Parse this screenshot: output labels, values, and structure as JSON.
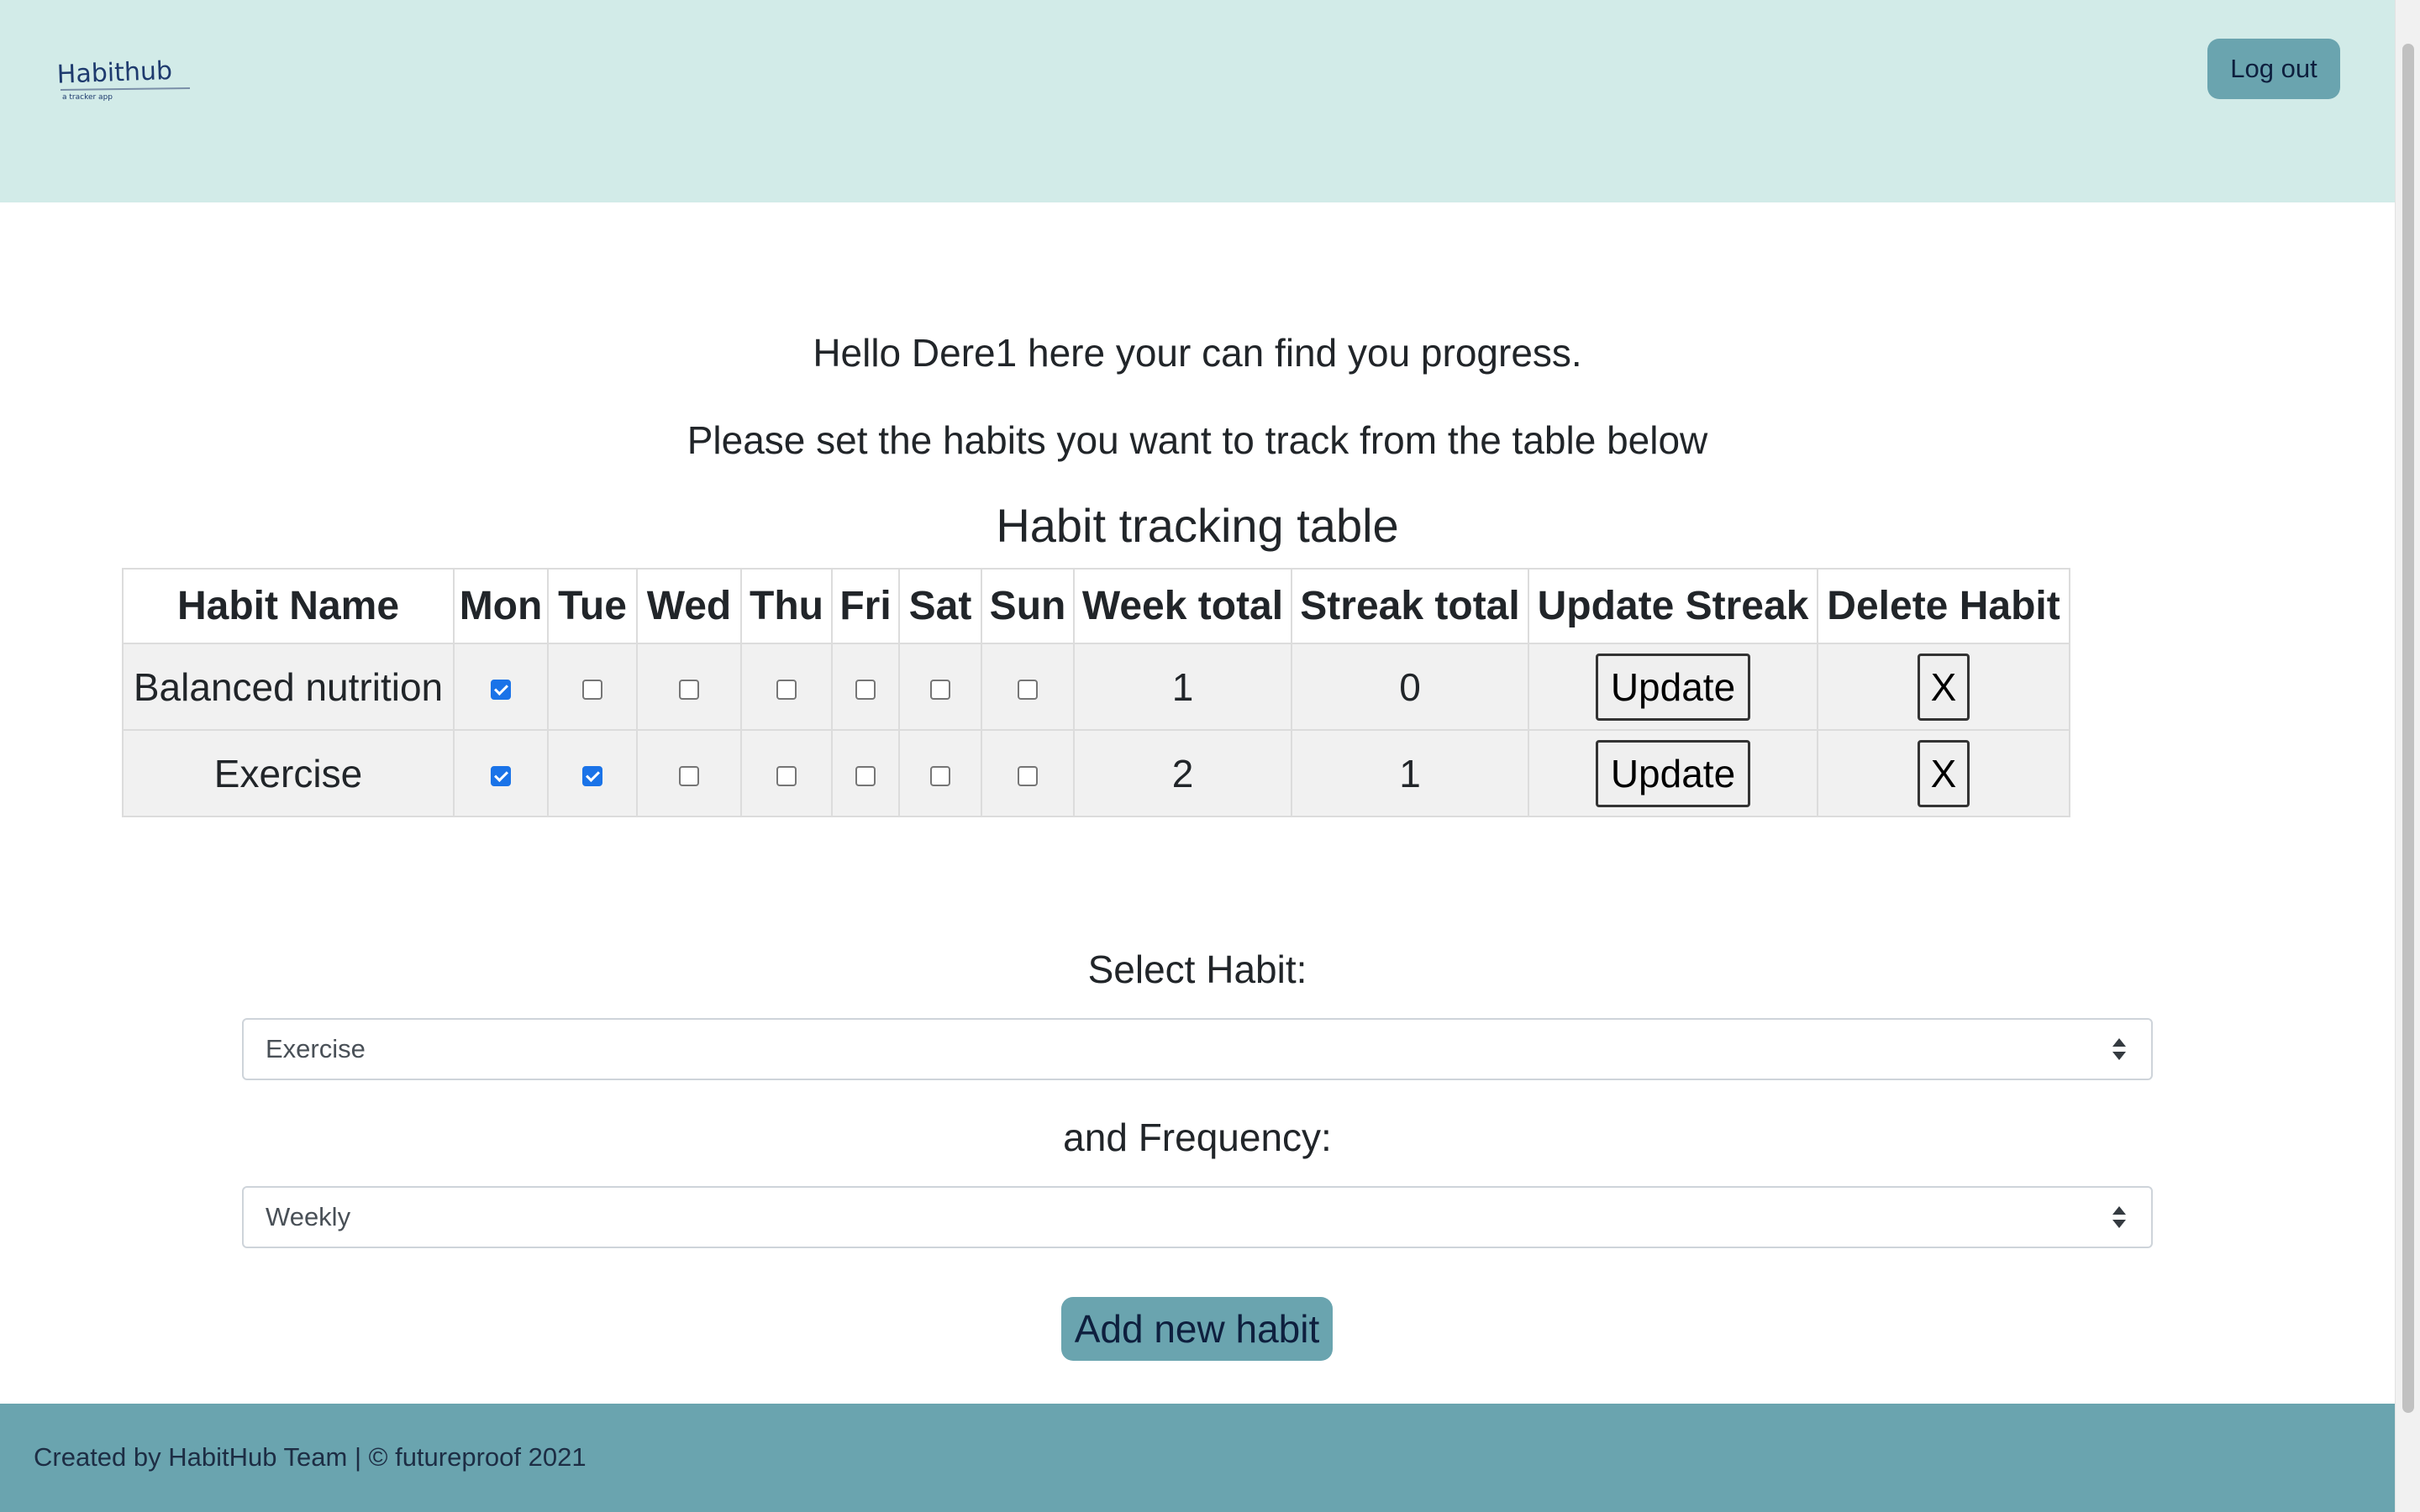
{
  "header": {
    "logo_text": "Habithub",
    "logo_tagline": "a tracker app",
    "logout_label": "Log out"
  },
  "intro": {
    "greeting": "Hello Dere1 here your can find you progress.",
    "instruction": "Please set the habits you want to track from the table below"
  },
  "table": {
    "title": "Habit tracking table",
    "headers": {
      "habit_name": "Habit Name",
      "mon": "Mon",
      "tue": "Tue",
      "wed": "Wed",
      "thu": "Thu",
      "fri": "Fri",
      "sat": "Sat",
      "sun": "Sun",
      "week_total": "Week total",
      "streak_total": "Streak total",
      "update_streak": "Update Streak",
      "delete_habit": "Delete Habit"
    },
    "rows": [
      {
        "name": "Balanced nutrition",
        "days": [
          true,
          false,
          false,
          false,
          false,
          false,
          false
        ],
        "week_total": "1",
        "streak_total": "0",
        "update_label": "Update",
        "delete_label": "X"
      },
      {
        "name": "Exercise",
        "days": [
          true,
          true,
          false,
          false,
          false,
          false,
          false
        ],
        "week_total": "2",
        "streak_total": "1",
        "update_label": "Update",
        "delete_label": "X"
      }
    ]
  },
  "form": {
    "habit_label": "Select Habit:",
    "habit_selected": "Exercise",
    "frequency_label": "and Frequency:",
    "frequency_selected": "Weekly",
    "add_label": "Add new habit"
  },
  "footer": {
    "text": "Created by HabitHub Team | © futureproof 2021"
  },
  "colors": {
    "header_bg": "#d2ebe8",
    "accent": "#6aa4af",
    "button_text": "#0e1f3e",
    "checkbox_checked": "#1a73e8",
    "table_row_bg": "#f1f1f1"
  }
}
